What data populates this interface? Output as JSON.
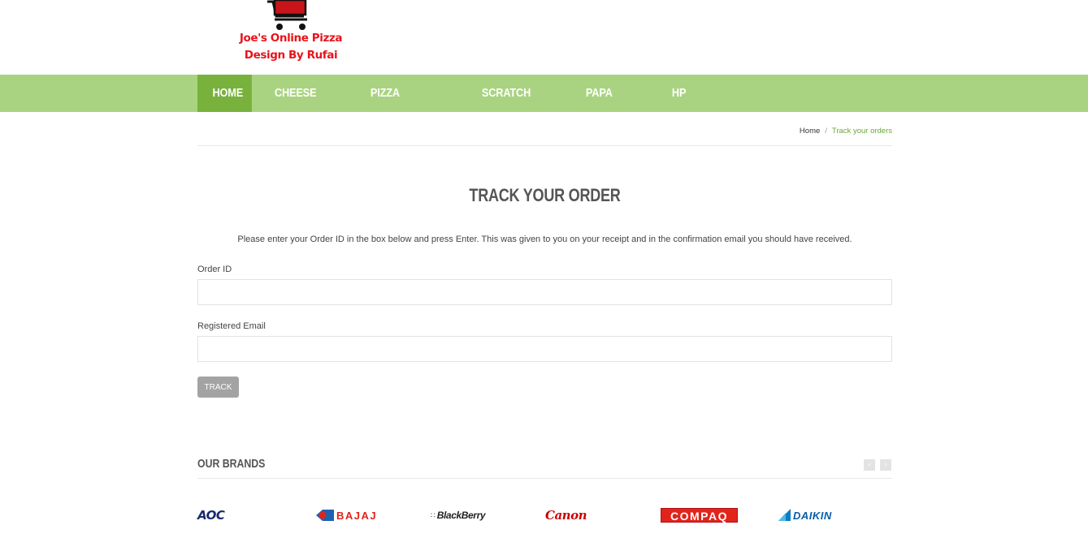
{
  "logo": {
    "line1": "Joe's Online Pizza",
    "line2": "Design By Rufai",
    "icon": "shopping-cart-icon"
  },
  "nav": {
    "items": [
      {
        "label": "HOME",
        "active": true
      },
      {
        "label": "CHEESE PIZZA",
        "active": false
      },
      {
        "label": "PIZZA VEGETABLE",
        "active": false
      },
      {
        "label": "SCRATCH PIZZA",
        "active": false
      },
      {
        "label": "PAPA PIZZA",
        "active": false
      },
      {
        "label": "HP LAPTOP",
        "active": false
      }
    ]
  },
  "breadcrumb": {
    "home": "Home",
    "separator": "/",
    "current": "Track your orders"
  },
  "page": {
    "title": "TRACK YOUR ORDER",
    "intro": "Please enter your Order ID in the box below and press Enter. This was given to you on your receipt and in the confirmation email you should have received."
  },
  "form": {
    "order_id_label": "Order ID",
    "order_id_value": "",
    "email_label": "Registered Email",
    "email_value": "",
    "track_label": "TRACK"
  },
  "brands": {
    "title": "OUR BRANDS",
    "prev_icon": "chevron-left-icon",
    "next_icon": "chevron-right-icon",
    "items": [
      "AOC",
      "BAJAJ",
      "BlackBerry",
      "Canon",
      "COMPAQ",
      "DAIKIN"
    ]
  },
  "colors": {
    "nav_bg": "#a9d380",
    "nav_active": "#79b13d",
    "logo_red": "#e8131a",
    "breadcrumb_current": "#6aa83a",
    "button_bg": "#a3a3a3"
  }
}
